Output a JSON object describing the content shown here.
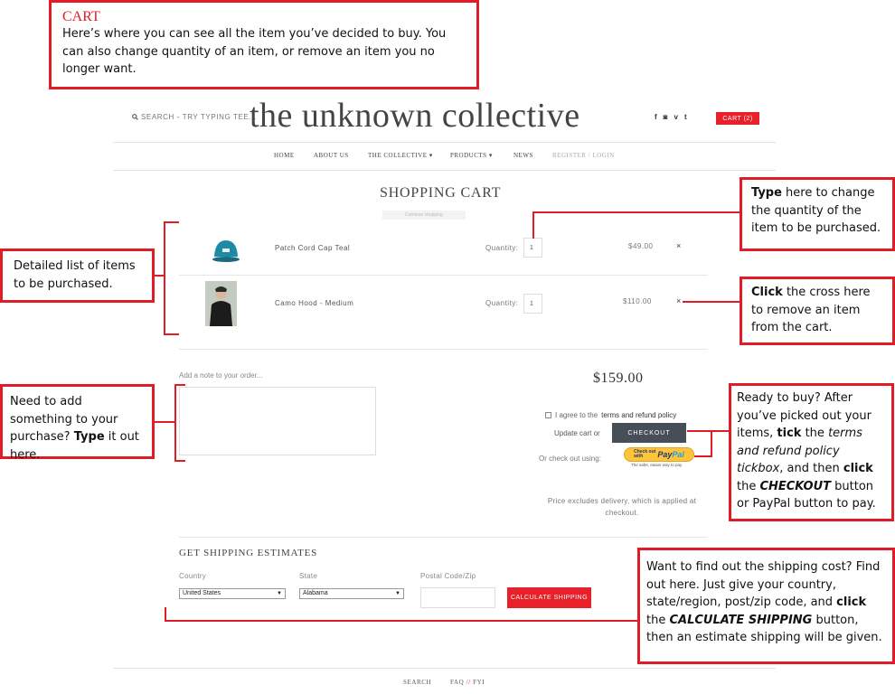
{
  "header": {
    "search_placeholder": "SEARCH - TRY TYPING TEE...",
    "logo": "the unknown collective",
    "social": [
      "f",
      "◙",
      "v",
      "t"
    ],
    "cart_label": "CART (2)"
  },
  "nav": {
    "home": "HOME",
    "about": "ABOUT US",
    "collective": "THE COLLECTIVE",
    "products": "PRODUCTS",
    "news": "NEWS",
    "login": "REGISTER / LOGIN"
  },
  "cart": {
    "title": "SHOPPING CART",
    "continue": "Continue shopping",
    "items": [
      {
        "name": "Patch Cord Cap Teal",
        "qty_label": "Quantity:",
        "qty": "1",
        "price": "$49.00",
        "remove": "×"
      },
      {
        "name": "Camo Hood - Medium",
        "qty_label": "Quantity:",
        "qty": "1",
        "price": "$110.00",
        "remove": "×"
      }
    ],
    "note_label": "Add a note to your order...",
    "total": "$159.00",
    "agree_prefix": "I agree to the",
    "agree_link": "terms and refund policy",
    "update_cart": "Update cart",
    "or": "or",
    "checkout": "CHECKOUT",
    "checkout_using": "Or check out using:",
    "paypal_small_1": "Check out",
    "paypal_small_2": "with",
    "paypal_pay": "Pay",
    "paypal_pal": "Pal",
    "paypal_tagline": "The safer, easier way to pay",
    "excludes": "Price excludes delivery, which is applied at checkout."
  },
  "shipping": {
    "title": "GET SHIPPING ESTIMATES",
    "country_label": "Country",
    "country_value": "United States",
    "state_label": "State",
    "state_value": "Alabama",
    "zip_label": "Postal Code/Zip",
    "calculate": "CALCULATE SHIPPING"
  },
  "footer": {
    "search": "SEARCH",
    "faq": "FAQ",
    "sep": "//",
    "fyi": "FYI"
  },
  "annotations": {
    "cart_title": "CART",
    "cart_text": "Here’s where you can see all the item you’ve decided to buy. You can also change quantity of an item, or remove an item you no longer want.",
    "list_text": "Detailed list of items to be purchased.",
    "qty_bold": "Type",
    "qty_text": " here to change the quantity of the item to be purchased.",
    "remove_bold": "Click",
    "remove_text": " the cross here to remove an item from the cart.",
    "note_text_1": "Need to add something to your purchase? ",
    "note_bold": "Type",
    "note_text_2": " it out here.",
    "checkout_1": "Ready to buy? After you’ve picked out your items, ",
    "checkout_tick": "tick",
    "checkout_2": " the ",
    "checkout_terms": "terms and refund policy tickbox",
    "checkout_3": ", and then ",
    "checkout_click": "click",
    "checkout_4": " the ",
    "checkout_btn": "CHECKOUT",
    "checkout_5": " button or PayPal button to pay.",
    "ship_1": "Want to find out the shipping cost? Find out here. Just give your country, state/region, post/zip code, and ",
    "ship_click": "click",
    "ship_2": " the ",
    "ship_btn": "CALCULATE SHIPPING",
    "ship_3": " button, then an estimate shipping will be given."
  },
  "colors": {
    "accent_red": "#e8202a",
    "callout_red": "#e21c26",
    "checkout_dark": "#464e58",
    "cap_teal": "#1f8aa6"
  }
}
